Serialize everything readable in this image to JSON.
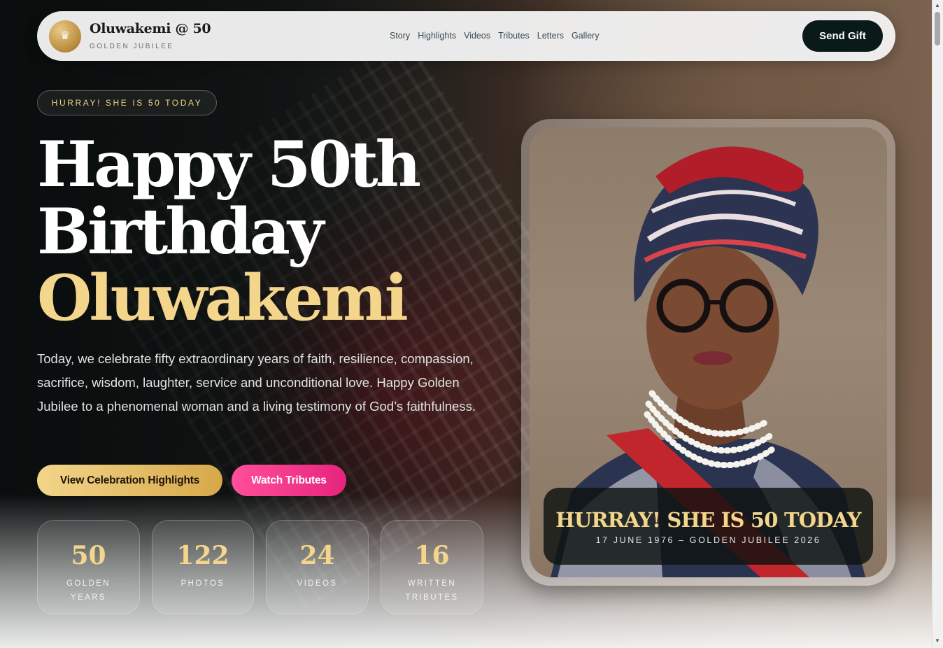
{
  "nav": {
    "logo_glyph": "♛",
    "brand_title": "Oluwakemi @ 50",
    "brand_subtitle": "GOLDEN JUBILEE",
    "links": [
      "Story",
      "Highlights",
      "Videos",
      "Tributes",
      "Letters",
      "Gallery"
    ],
    "cta": "Send Gift"
  },
  "hero": {
    "badge": "HURRAY! SHE IS 50 TODAY",
    "heading_line1": "Happy 50th",
    "heading_line2": "Birthday",
    "heading_line3": "Oluwakemi",
    "intro": "Today, we celebrate fifty extraordinary years of faith, resilience, compassion, sacrifice, wisdom, laughter, service and unconditional love. Happy Golden Jubilee to a phenomenal woman and a living testimony of God’s faithfulness.",
    "primary_button": "View Celebration Highlights",
    "secondary_button": "Watch Tributes"
  },
  "stats": [
    {
      "value": "50",
      "label": "GOLDEN YEARS"
    },
    {
      "value": "122",
      "label": "PHOTOS"
    },
    {
      "value": "24",
      "label": "VIDEOS"
    },
    {
      "value": "16",
      "label": "WRITTEN TRIBUTES"
    }
  ],
  "portrait": {
    "caption_title": "HURRAY! SHE IS 50 TODAY",
    "caption_subtitle": "17 JUNE 1976 – GOLDEN JUBILEE 2026"
  },
  "colors": {
    "accent_gold": "#f3d58c",
    "accent_pink": "#e6247d",
    "nav_dark": "#0a1a18"
  },
  "icons": {
    "logo": "crown-icon",
    "scroll_up": "scroll-up-arrow-icon",
    "scroll_down": "scroll-down-arrow-icon"
  }
}
